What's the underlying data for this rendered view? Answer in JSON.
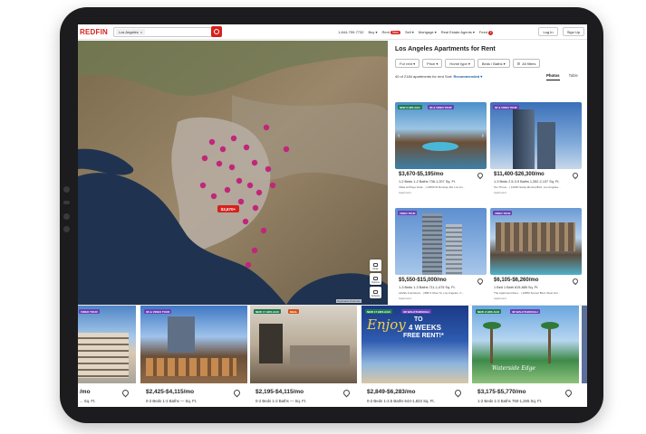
{
  "header": {
    "logo": "REDFIN",
    "search_chip": "Los Angeles",
    "phone": "1-844-759-7732",
    "nav": [
      {
        "label": "Buy ▾"
      },
      {
        "label": "Rent",
        "badge": "New"
      },
      {
        "label": "Sell ▾"
      },
      {
        "label": "Mortgage ▾"
      },
      {
        "label": "Real Estate Agents ▾"
      },
      {
        "label": "Feed",
        "count": "2"
      }
    ],
    "login": "Log In",
    "signup": "Sign Up"
  },
  "map": {
    "controls": [
      {
        "label": "Draw",
        "icon": "draw-icon"
      },
      {
        "label": "Options",
        "icon": "layers-icon"
      },
      {
        "label": "Schools",
        "icon": "school-icon"
      }
    ],
    "zoom_in": "+",
    "zoom_out": "−",
    "attribution": "Keyboard shortcuts",
    "selected_pin": "$3,670+",
    "colors": {
      "pin": "#c1267a",
      "water": "#1f3350",
      "land": "#8c7a5c"
    }
  },
  "results": {
    "title": "Los Angeles Apartments for Rent",
    "filters": [
      "For rent ▾",
      "Price ▾",
      "Home type ▾",
      "Beds / Baths ▾",
      "All filters"
    ],
    "count_text": "40 of 2184 apartments for rent",
    "sort_label": "Sort:",
    "sort_value": "Recommended ▾",
    "view_tabs": [
      "Photos",
      "Table"
    ],
    "cards": [
      {
        "tag": "NEW 3 HRS AGO",
        "tag2": "3D & VIDEO TOUR",
        "price": "$3,670-$5,195/mo",
        "meta": "1-2 Beds   1-2 Baths   736-1,207 Sq. Ft.",
        "addr": "Villas at Playa Vista... | 12600 W Runway Rd, Los An...",
        "ptype": "Apartment"
      },
      {
        "tag": "3D & VIDEO TOUR",
        "tag2": "",
        "price": "$11,400-$26,300/mo",
        "meta": "1-3 Beds   2.5-3.5 Baths   1,352-2,137 Sq. Ft.",
        "addr": "Ten Thous... | 10000 Santa Monica Blvd, Los Angeles...",
        "ptype": "Apartment"
      },
      {
        "tag": "VIDEO TOUR",
        "tag2": "",
        "price": "$5,550-$15,000/mo",
        "meta": "1-3 Beds   1-3 Baths   711-1,475 Sq. Ft.",
        "addr": "LEVEL Furnished... | 888 S Olive St, Los Angeles, C...",
        "ptype": "Apartment"
      },
      {
        "tag": "VIDEO TOUR",
        "tag2": "",
        "price": "$6,105-$6,260/mo",
        "meta": "1 Bed   1 Bath   815-885 Sq. Ft.",
        "addr": "The Apartment Resi... | 10550 Sunset Blvd, West Hol...",
        "ptype": "Apartment"
      }
    ]
  },
  "strip": {
    "cards": [
      {
        "tag": "VIDEO TOUR",
        "price": "/mo",
        "meta": "... Sq. Ft."
      },
      {
        "tag": "3D & VIDEO TOUR",
        "price": "$2,425-$4,115/mo",
        "meta": "0-2 Beds   1-2 Baths   — Sq. Ft."
      },
      {
        "tag": "NEW 17 HRS AGO",
        "tag2": "DEAL",
        "price": "$2,195-$4,115/mo",
        "meta": "0-2 Beds   1-2 Baths   — Sq. Ft."
      },
      {
        "tag": "NEW 17 HRS AGO",
        "tag2": "3D WALKTHROUGH",
        "price": "$2,849-$6,283/mo",
        "meta": "0-2 Beds   1-2.5 Baths   644-1,823 Sq. Ft.",
        "promo_top": "TO",
        "promo_mid": "4 WEEKS",
        "promo_bottom": "FREE RENT!*",
        "promo_script": "Enjoy"
      },
      {
        "tag": "NEW 2 HRS AGO",
        "tag2": "3D WALKTHROUGH",
        "price": "$3,175-$5,770/mo",
        "meta": "1-2 Beds   1-2 Baths   750-1,265 Sq. Ft.",
        "sign": "Waterside Edge"
      }
    ]
  }
}
